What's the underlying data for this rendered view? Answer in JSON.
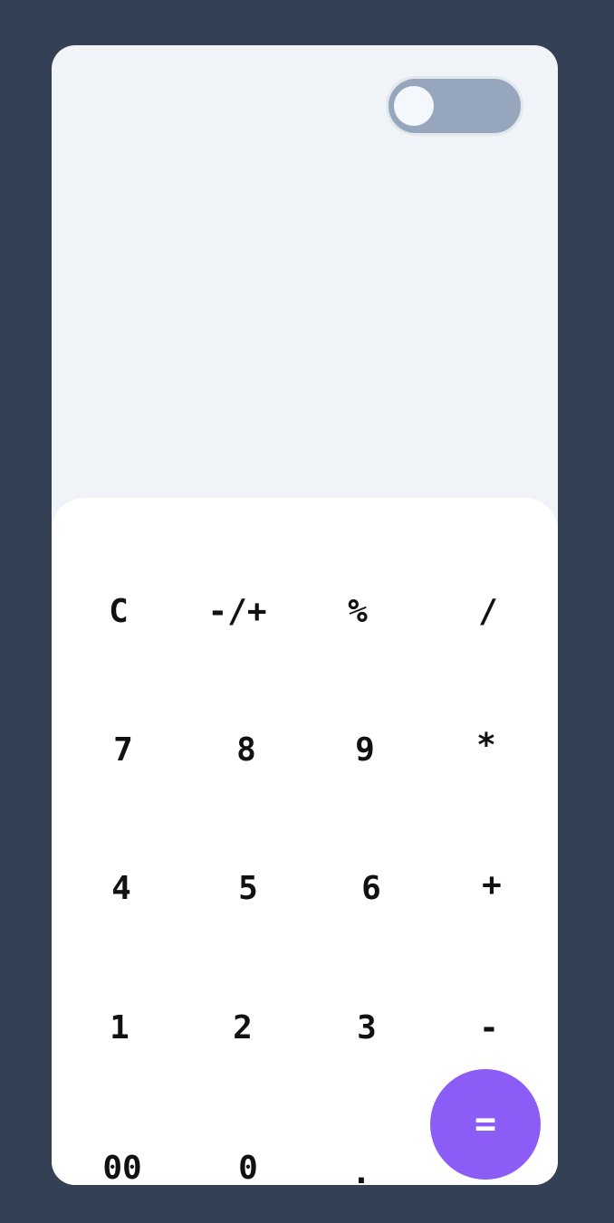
{
  "theme": {
    "background": "#344154",
    "panel": "#f0f4f9",
    "keypad": "#ffffff",
    "accent": "#8b5cf6",
    "toggle_track": "#96a7bd"
  },
  "toggle": {
    "state": "off"
  },
  "display": {
    "expression": "",
    "result": ""
  },
  "keys": {
    "clear": "C",
    "negate": "-/+",
    "percent": "%",
    "divide": "/",
    "seven": "7",
    "eight": "8",
    "nine": "9",
    "multiply": "*",
    "four": "4",
    "five": "5",
    "six": "6",
    "add": "+",
    "one": "1",
    "two": "2",
    "three": "3",
    "subtract": "-",
    "double_zero": "00",
    "zero": "0",
    "decimal": ".",
    "equals": "="
  }
}
